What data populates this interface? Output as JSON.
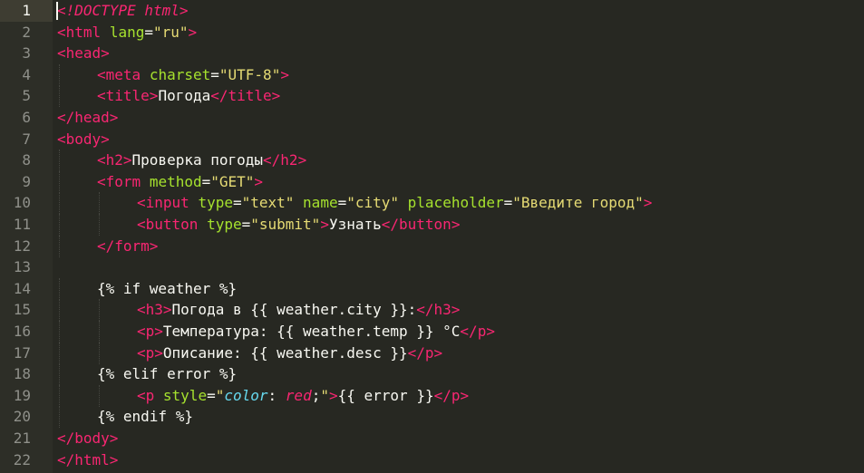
{
  "editor": {
    "theme": "monokai",
    "colors": {
      "background": "#272822",
      "gutter": "#2d2e27",
      "tag": "#f92672",
      "attribute": "#a6e22e",
      "string": "#e6db74",
      "text": "#f8f8f2",
      "line_number": "#8f908a",
      "css_property": "#66d9ef"
    },
    "active_line": 1,
    "lines": [
      {
        "n": "1",
        "indent": 0,
        "tokens": [
          {
            "c": "tag",
            "t": "<"
          },
          {
            "c": "doc",
            "t": "!DOCTYPE html"
          },
          {
            "c": "tag",
            "t": ">"
          }
        ]
      },
      {
        "n": "2",
        "indent": 0,
        "tokens": [
          {
            "c": "tag",
            "t": "<html"
          },
          {
            "c": "txt",
            "t": " "
          },
          {
            "c": "attr",
            "t": "lang"
          },
          {
            "c": "txt",
            "t": "="
          },
          {
            "c": "str",
            "t": "\"ru\""
          },
          {
            "c": "tag",
            "t": ">"
          }
        ]
      },
      {
        "n": "3",
        "indent": 0,
        "tokens": [
          {
            "c": "tag",
            "t": "<head>"
          }
        ]
      },
      {
        "n": "4",
        "indent": 1,
        "tokens": [
          {
            "c": "tag",
            "t": "<meta"
          },
          {
            "c": "txt",
            "t": " "
          },
          {
            "c": "attr",
            "t": "charset"
          },
          {
            "c": "txt",
            "t": "="
          },
          {
            "c": "str",
            "t": "\"UTF-8\""
          },
          {
            "c": "tag",
            "t": ">"
          }
        ]
      },
      {
        "n": "5",
        "indent": 1,
        "tokens": [
          {
            "c": "tag",
            "t": "<title>"
          },
          {
            "c": "txt",
            "t": "Погода"
          },
          {
            "c": "tag",
            "t": "</title>"
          }
        ]
      },
      {
        "n": "6",
        "indent": 0,
        "tokens": [
          {
            "c": "tag",
            "t": "</head>"
          }
        ]
      },
      {
        "n": "7",
        "indent": 0,
        "tokens": [
          {
            "c": "tag",
            "t": "<body>"
          }
        ]
      },
      {
        "n": "8",
        "indent": 1,
        "tokens": [
          {
            "c": "tag",
            "t": "<h2>"
          },
          {
            "c": "txt",
            "t": "Проверка погоды"
          },
          {
            "c": "tag",
            "t": "</h2>"
          }
        ]
      },
      {
        "n": "9",
        "indent": 1,
        "tokens": [
          {
            "c": "tag",
            "t": "<form"
          },
          {
            "c": "txt",
            "t": " "
          },
          {
            "c": "attr",
            "t": "method"
          },
          {
            "c": "txt",
            "t": "="
          },
          {
            "c": "str",
            "t": "\"GET\""
          },
          {
            "c": "tag",
            "t": ">"
          }
        ]
      },
      {
        "n": "10",
        "indent": 2,
        "tokens": [
          {
            "c": "tag",
            "t": "<input"
          },
          {
            "c": "txt",
            "t": " "
          },
          {
            "c": "attr",
            "t": "type"
          },
          {
            "c": "txt",
            "t": "="
          },
          {
            "c": "str",
            "t": "\"text\""
          },
          {
            "c": "txt",
            "t": " "
          },
          {
            "c": "attr",
            "t": "name"
          },
          {
            "c": "txt",
            "t": "="
          },
          {
            "c": "str",
            "t": "\"city\""
          },
          {
            "c": "txt",
            "t": " "
          },
          {
            "c": "attr",
            "t": "placeholder"
          },
          {
            "c": "txt",
            "t": "="
          },
          {
            "c": "str",
            "t": "\"Введите город\""
          },
          {
            "c": "tag",
            "t": ">"
          }
        ]
      },
      {
        "n": "11",
        "indent": 2,
        "tokens": [
          {
            "c": "tag",
            "t": "<button"
          },
          {
            "c": "txt",
            "t": " "
          },
          {
            "c": "attr",
            "t": "type"
          },
          {
            "c": "txt",
            "t": "="
          },
          {
            "c": "str",
            "t": "\"submit\""
          },
          {
            "c": "tag",
            "t": ">"
          },
          {
            "c": "txt",
            "t": "Узнать"
          },
          {
            "c": "tag",
            "t": "</button>"
          }
        ]
      },
      {
        "n": "12",
        "indent": 1,
        "tokens": [
          {
            "c": "tag",
            "t": "</form>"
          }
        ]
      },
      {
        "n": "13",
        "indent": 0,
        "tokens": []
      },
      {
        "n": "14",
        "indent": 1,
        "tokens": [
          {
            "c": "txt",
            "t": "{% if weather %}"
          }
        ]
      },
      {
        "n": "15",
        "indent": 2,
        "tokens": [
          {
            "c": "tag",
            "t": "<h3>"
          },
          {
            "c": "txt",
            "t": "Погода в {{ weather.city }}:"
          },
          {
            "c": "tag",
            "t": "</h3>"
          }
        ]
      },
      {
        "n": "16",
        "indent": 2,
        "tokens": [
          {
            "c": "tag",
            "t": "<p>"
          },
          {
            "c": "txt",
            "t": "Температура: {{ weather.temp }} °C"
          },
          {
            "c": "tag",
            "t": "</p>"
          }
        ]
      },
      {
        "n": "17",
        "indent": 2,
        "tokens": [
          {
            "c": "tag",
            "t": "<p>"
          },
          {
            "c": "txt",
            "t": "Описание: {{ weather.desc }}"
          },
          {
            "c": "tag",
            "t": "</p>"
          }
        ]
      },
      {
        "n": "18",
        "indent": 1,
        "tokens": [
          {
            "c": "txt",
            "t": "{% elif error %}"
          }
        ]
      },
      {
        "n": "19",
        "indent": 2,
        "tokens": [
          {
            "c": "tag",
            "t": "<p"
          },
          {
            "c": "txt",
            "t": " "
          },
          {
            "c": "attr",
            "t": "style"
          },
          {
            "c": "txt",
            "t": "="
          },
          {
            "c": "str",
            "t": "\""
          },
          {
            "c": "css",
            "t": "color"
          },
          {
            "c": "txt",
            "t": ": "
          },
          {
            "c": "cssv",
            "t": "red"
          },
          {
            "c": "txt",
            "t": ";"
          },
          {
            "c": "str",
            "t": "\""
          },
          {
            "c": "tag",
            "t": ">"
          },
          {
            "c": "txt",
            "t": "{{ error }}"
          },
          {
            "c": "tag",
            "t": "</p>"
          }
        ]
      },
      {
        "n": "20",
        "indent": 1,
        "tokens": [
          {
            "c": "txt",
            "t": "{% endif %}"
          }
        ]
      },
      {
        "n": "21",
        "indent": 0,
        "tokens": [
          {
            "c": "tag",
            "t": "</body>"
          }
        ]
      },
      {
        "n": "22",
        "indent": 0,
        "tokens": [
          {
            "c": "tag",
            "t": "</html>"
          }
        ]
      }
    ]
  }
}
